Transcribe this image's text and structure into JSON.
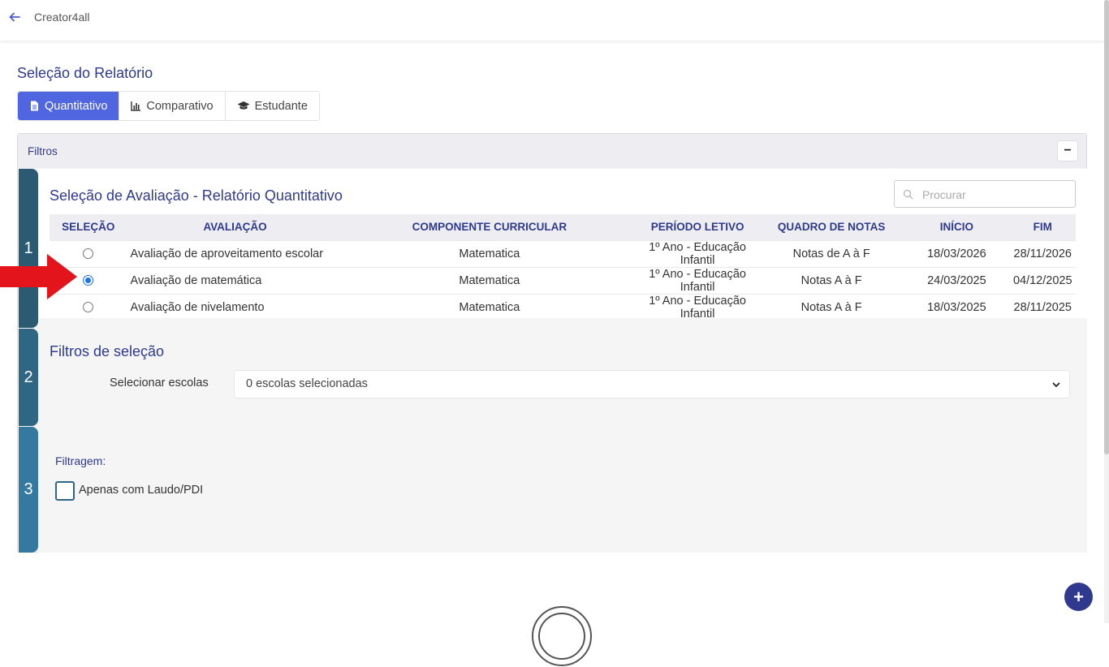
{
  "header": {
    "title": "Creator4all",
    "back_icon": "arrow-left-icon"
  },
  "report_selection": {
    "title": "Seleção do Relatório",
    "tabs": [
      {
        "label": "Quantitativo",
        "icon": "document-icon",
        "active": true
      },
      {
        "label": "Comparativo",
        "icon": "bar-chart-icon",
        "active": false
      },
      {
        "label": "Estudante",
        "icon": "graduation-cap-icon",
        "active": false
      }
    ]
  },
  "filters_panel": {
    "title": "Filtros",
    "collapse_label": "−",
    "steps": [
      "1",
      "2",
      "3"
    ],
    "evaluation": {
      "title": "Seleção de Avaliação - Relatório Quantitativo",
      "search_placeholder": "Procurar",
      "columns": [
        "SELEÇÃO",
        "AVALIAÇÃO",
        "COMPONENTE CURRICULAR",
        "PERÍODO LETIVO",
        "QUADRO DE NOTAS",
        "INÍCIO",
        "FIM"
      ],
      "rows": [
        {
          "selected": false,
          "avaliacao": "Avaliação de aproveitamento escolar",
          "componente": "Matematica",
          "periodo": "1º Ano - Educação Infantil",
          "quadro": "Notas de A à F",
          "inicio": "18/03/2026",
          "fim": "28/11/2026"
        },
        {
          "selected": true,
          "avaliacao": "Avaliação de matemática",
          "componente": "Matematica",
          "periodo": "1º Ano - Educação Infantil",
          "quadro": "Notas A à F",
          "inicio": "24/03/2025",
          "fim": "04/12/2025"
        },
        {
          "selected": false,
          "avaliacao": "Avaliação de nivelamento",
          "componente": "Matematica",
          "periodo": "1º Ano - Educação Infantil",
          "quadro": "Notas A à F",
          "inicio": "18/03/2025",
          "fim": "28/11/2025"
        }
      ]
    },
    "selection_filters": {
      "title": "Filtros de seleção",
      "school_label": "Selecionar escolas",
      "school_value": "0 escolas selecionadas"
    },
    "filtering": {
      "label": "Filtragem:",
      "checkbox_label": "Apenas com Laudo/PDI",
      "checked": false
    }
  },
  "fab_label": "+",
  "colors": {
    "primary": "#2f3a8f",
    "active_tab": "#5066e0",
    "step": "#2f6683",
    "arrow": "#e3141b"
  }
}
